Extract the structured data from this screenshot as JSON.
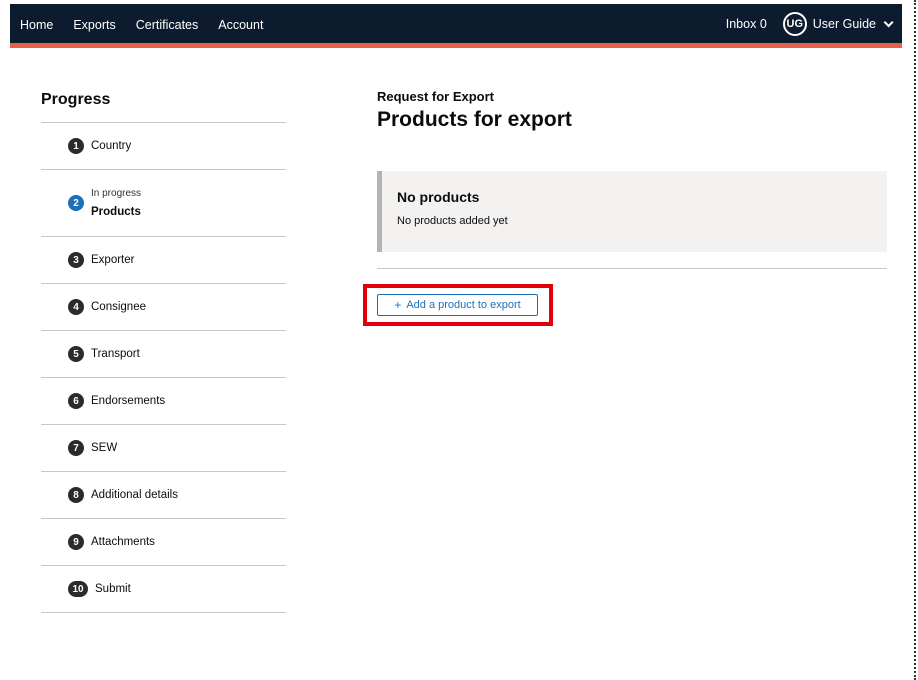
{
  "header": {
    "nav": [
      "Home",
      "Exports",
      "Certificates",
      "Account"
    ],
    "inbox_label": "Inbox",
    "inbox_count": "0",
    "avatar_initials": "UG",
    "user_name": "User Guide",
    "bar_color": "#0d1b2e",
    "accent_color": "#e4614b"
  },
  "sidebar": {
    "title": "Progress",
    "steps": [
      {
        "num": "1",
        "label": "Country"
      },
      {
        "num": "2",
        "label": "Products",
        "status": "In progress"
      },
      {
        "num": "3",
        "label": "Exporter"
      },
      {
        "num": "4",
        "label": "Consignee"
      },
      {
        "num": "5",
        "label": "Transport"
      },
      {
        "num": "6",
        "label": "Endorsements"
      },
      {
        "num": "7",
        "label": "SEW"
      },
      {
        "num": "8",
        "label": "Additional details"
      },
      {
        "num": "9",
        "label": "Attachments"
      },
      {
        "num": "10",
        "label": "Submit"
      }
    ]
  },
  "main": {
    "caption": "Request for Export",
    "heading": "Products for export",
    "inset_title": "No products",
    "inset_text": "No products added yet",
    "add_button_label": "Add a product to export",
    "highlight_color": "#e3000b"
  }
}
